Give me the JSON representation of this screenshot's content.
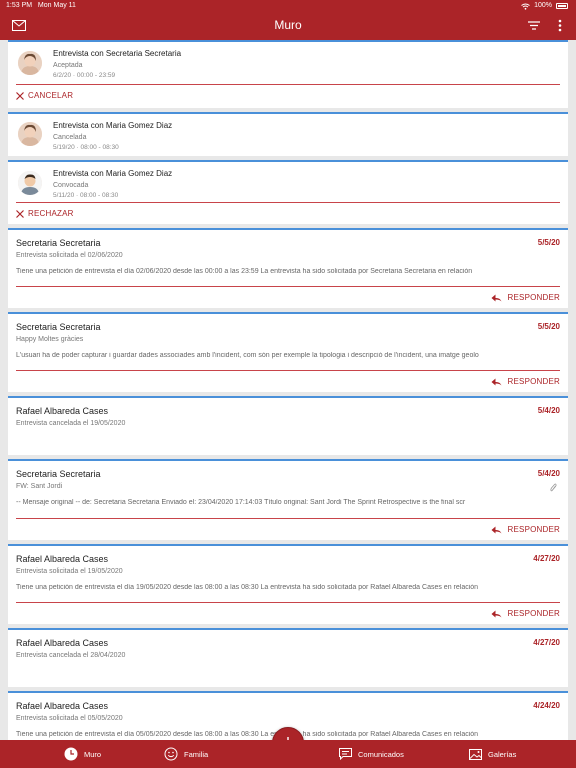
{
  "status_bar": {
    "time": "1:53 PM",
    "date": "Mon May 11",
    "battery": "100%"
  },
  "navbar": {
    "title": "Muro"
  },
  "meetings": [
    {
      "title": "Entrevista con Secretaria Secretaria",
      "status": "Aceptada",
      "time": "6/2/20 · 00:00 - 23:59",
      "action": "CANCELAR"
    },
    {
      "title": "Entrevista con Maria Gomez Diaz",
      "status": "Cancelada",
      "time": "5/19/20 · 08:00 - 08:30"
    },
    {
      "title": "Entrevista con Maria Gomez Diaz",
      "status": "Convocada",
      "time": "5/11/20 · 08:00 - 08:30",
      "action": "RECHAZAR"
    }
  ],
  "messages": [
    {
      "sender": "Secretaria Secretaria",
      "date": "5/5/20",
      "subject": "Entrevista solicitada el 02/06/2020",
      "body": "Tiene una petición de entrevista el día 02/06/2020 desde las 00:00 a las 23:59 La entrevista ha sido solicitada por Secretaria Secretaria en relación",
      "reply": "RESPONDER"
    },
    {
      "sender": "Secretaria Secretaria",
      "date": "5/5/20",
      "subject": "Happy Moltes gràcies",
      "body": "L'usuari ha de poder capturar i guardar dades associades amb l'incident, com són per exemple la tipologia i descripció de l'incident, una imatge geolo",
      "reply": "RESPONDER"
    },
    {
      "sender": "Rafael Albareda Cases",
      "date": "5/4/20",
      "subject": "Entrevista cancelada el 19/05/2020",
      "body": ""
    },
    {
      "sender": "Secretaria Secretaria",
      "date": "5/4/20",
      "subject": "FW: Sant Jordi",
      "body": "-- Mensaje original -- de: Secretaria Secretaria Enviado el: 23/04/2020 17:14:03 Título original: Sant Jordi The Sprint Retrospective is the final scr",
      "reply": "RESPONDER"
    },
    {
      "sender": "Rafael Albareda Cases",
      "date": "4/27/20",
      "subject": "Entrevista solicitada el 19/05/2020",
      "body": "Tiene una petición de entrevista el día 19/05/2020 desde las 08:00 a las 08:30 La entrevista ha sido solicitada por Rafael Albareda Cases en relación",
      "reply": "RESPONDER"
    },
    {
      "sender": "Rafael Albareda Cases",
      "date": "4/27/20",
      "subject": "Entrevista cancelada el 28/04/2020",
      "body": ""
    },
    {
      "sender": "Rafael Albareda Cases",
      "date": "4/24/20",
      "subject": "Entrevista solicitada el 05/05/2020",
      "body": "Tiene una petición de entrevista el día 05/05/2020 desde las 08:00 a las 08:30 La entrevista ha sido solicitada por Rafael Albareda Cases en relación"
    }
  ],
  "tabs": [
    {
      "label": "Muro",
      "icon": "clock-icon"
    },
    {
      "label": "Familia",
      "icon": "smiley-icon"
    },
    {
      "label": "Comunicados",
      "icon": "chat-icon"
    },
    {
      "label": "Galerías",
      "icon": "gallery-icon"
    }
  ],
  "colors": {
    "brand": "#ab2428",
    "accent_line": "#4a90d9"
  }
}
